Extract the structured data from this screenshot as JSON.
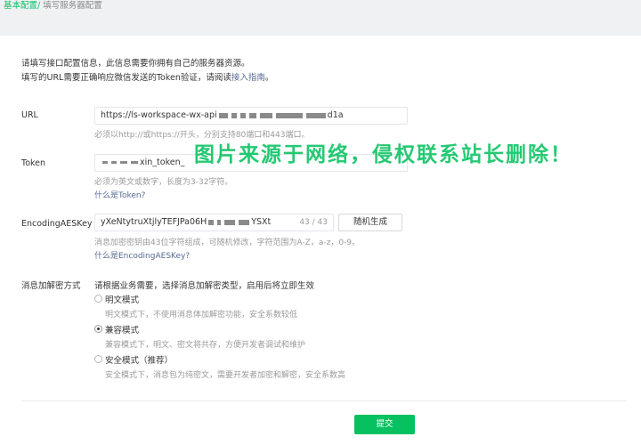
{
  "breadcrumb": {
    "current": "基本配置/",
    "sub": " 填写服务器配置"
  },
  "intro": {
    "line1": "请填写接口配置信息，此信息需要你拥有自己的服务器资源。",
    "line2_prefix": "填写的URL需要正确响应微信发送的Token验证，请阅读",
    "line2_link": "接入指南",
    "line2_suffix": "。"
  },
  "url": {
    "label": "URL",
    "value_prefix": "https://ls-workspace-wx-api",
    "value_suffix": "d1a",
    "hint": "必须以http://或https://开头，分别支持80端口和443端口。"
  },
  "token": {
    "label": "Token",
    "value": "xin_token_",
    "hint": "必须为英文或数字，长度为3-32字符。",
    "link": "什么是Token?"
  },
  "aeskey": {
    "label": "EncodingAESKey",
    "value_prefix": "yXeNtytruXtjlyTEFJPa06H",
    "value_suffix": "YSXt",
    "count": "43 / 43",
    "generate_label": "随机生成",
    "hint": "消息加密密钥由43位字符组成，可随机修改，字符范围为A-Z，a-z，0-9。",
    "link": "什么是EncodingAESKey?"
  },
  "encryption": {
    "label": "消息加解密方式",
    "instruction": "请根据业务需要，选择消息加解密类型，启用后将立即生效",
    "options": [
      {
        "label": "明文模式",
        "desc": "明文模式下，不使用消息体加解密功能，安全系数较低",
        "selected": false
      },
      {
        "label": "兼容模式",
        "desc": "兼容模式下，明文、密文将共存，方便开发者调试和维护",
        "selected": true
      },
      {
        "label": "安全模式（推荐）",
        "desc": "安全模式下，消息包为纯密文，需要开发者加密和解密，安全系数高",
        "selected": false
      }
    ]
  },
  "submit_label": "提交",
  "watermark": "图片来源于网络，侵权联系站长删除！",
  "colors": {
    "accent": "#07c160",
    "link": "#576b95"
  }
}
